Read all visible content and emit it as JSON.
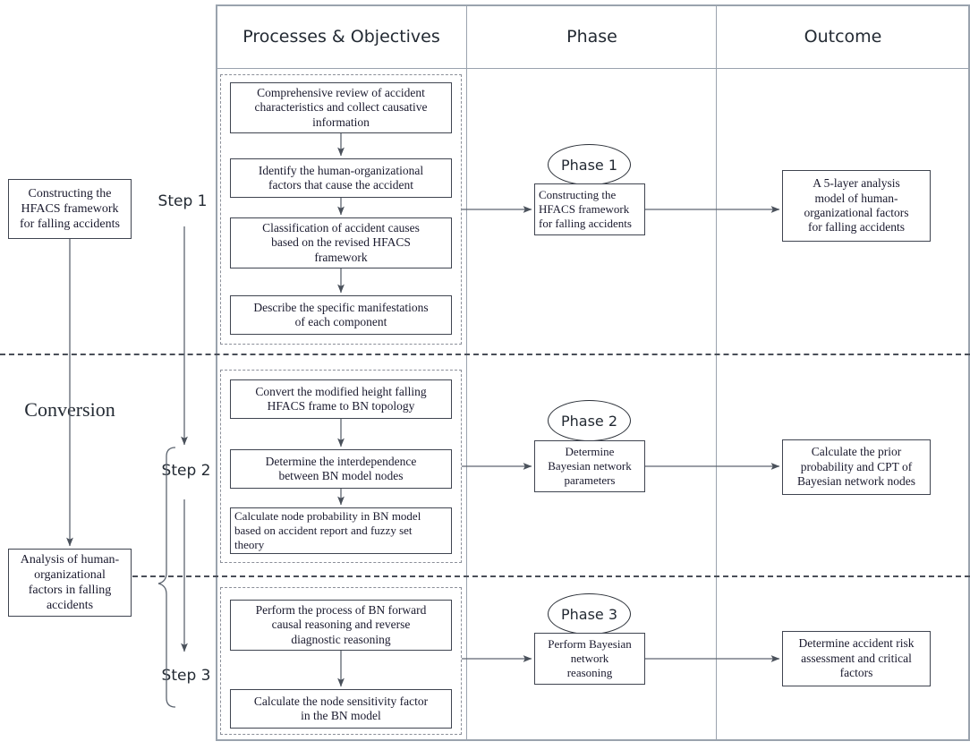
{
  "table": {
    "headers": [
      {
        "id": "processes",
        "label": "Processes & Objectives"
      },
      {
        "id": "phase",
        "label": "Phase"
      },
      {
        "id": "outcome",
        "label": "Outcome"
      }
    ]
  },
  "left_column": {
    "top_box": "Constructing the\nHFACS framework\nfor falling accidents",
    "top_box_lines": [
      "Constructing the",
      "HFACS framework",
      "for falling accidents"
    ],
    "conversion_label": "Conversion",
    "bottom_box_lines": [
      "Analysis of human-",
      "organizational",
      "factors in falling",
      "accidents"
    ]
  },
  "steps": [
    {
      "id": "step-1",
      "label": "Step 1"
    },
    {
      "id": "step-2",
      "label": "Step 2"
    },
    {
      "id": "step-3",
      "label": "Step 3"
    }
  ],
  "process_groups": [
    {
      "id": "group-1",
      "boxes": [
        {
          "id": "p1-1",
          "lines": [
            "Comprehensive review of accident",
            "characteristics and collect causative",
            "information"
          ],
          "align": "center"
        },
        {
          "id": "p1-2",
          "lines": [
            "Identify the human-organizational",
            "factors that cause the accident"
          ],
          "align": "center"
        },
        {
          "id": "p1-3",
          "lines": [
            "Classification of accident causes",
            "based on the revised HFACS",
            "framework"
          ],
          "align": "center"
        },
        {
          "id": "p1-4",
          "lines": [
            "Describe the specific manifestations",
            "of each component"
          ],
          "align": "center"
        }
      ]
    },
    {
      "id": "group-2",
      "boxes": [
        {
          "id": "p2-1",
          "lines": [
            "Convert the modified height falling",
            "HFACS frame to BN topology"
          ],
          "align": "center"
        },
        {
          "id": "p2-2",
          "lines": [
            "Determine the interdependence",
            "between BN model nodes"
          ],
          "align": "center"
        },
        {
          "id": "p2-3",
          "lines": [
            "Calculate node probability in BN model",
            "based on accident report and fuzzy set",
            "theory"
          ],
          "align": "left"
        }
      ]
    },
    {
      "id": "group-3",
      "boxes": [
        {
          "id": "p3-1",
          "lines": [
            "Perform the process of BN forward",
            "causal reasoning and reverse",
            "diagnostic reasoning"
          ],
          "align": "center"
        },
        {
          "id": "p3-2",
          "lines": [
            "Calculate the node sensitivity factor",
            "in the BN model"
          ],
          "align": "center"
        }
      ]
    }
  ],
  "phases": [
    {
      "id": "phase-1",
      "badge": "Phase 1",
      "box_lines": [
        "Constructing the",
        "HFACS framework",
        "for falling accidents"
      ],
      "align": "left"
    },
    {
      "id": "phase-2",
      "badge": "Phase 2",
      "box_lines": [
        "Determine",
        "Bayesian network",
        "parameters"
      ],
      "align": "center"
    },
    {
      "id": "phase-3",
      "badge": "Phase 3",
      "box_lines": [
        "Perform Bayesian",
        "network",
        "reasoning"
      ],
      "align": "center"
    }
  ],
  "outcomes": [
    {
      "id": "outcome-1",
      "lines": [
        "A 5-layer analysis",
        "model of human-",
        "organizational factors",
        "for falling accidents"
      ]
    },
    {
      "id": "outcome-2",
      "lines": [
        "Calculate the prior",
        "probability and CPT of",
        "Bayesian network nodes"
      ]
    },
    {
      "id": "outcome-3",
      "lines": [
        "Determine accident risk",
        "assessment and critical",
        "factors"
      ]
    }
  ],
  "colors": {
    "line": "#5d6570",
    "table_border": "#9aa3ae",
    "box_border": "#3f4450",
    "dash_border": "#8b8f99",
    "text": "#1a1a2e"
  }
}
